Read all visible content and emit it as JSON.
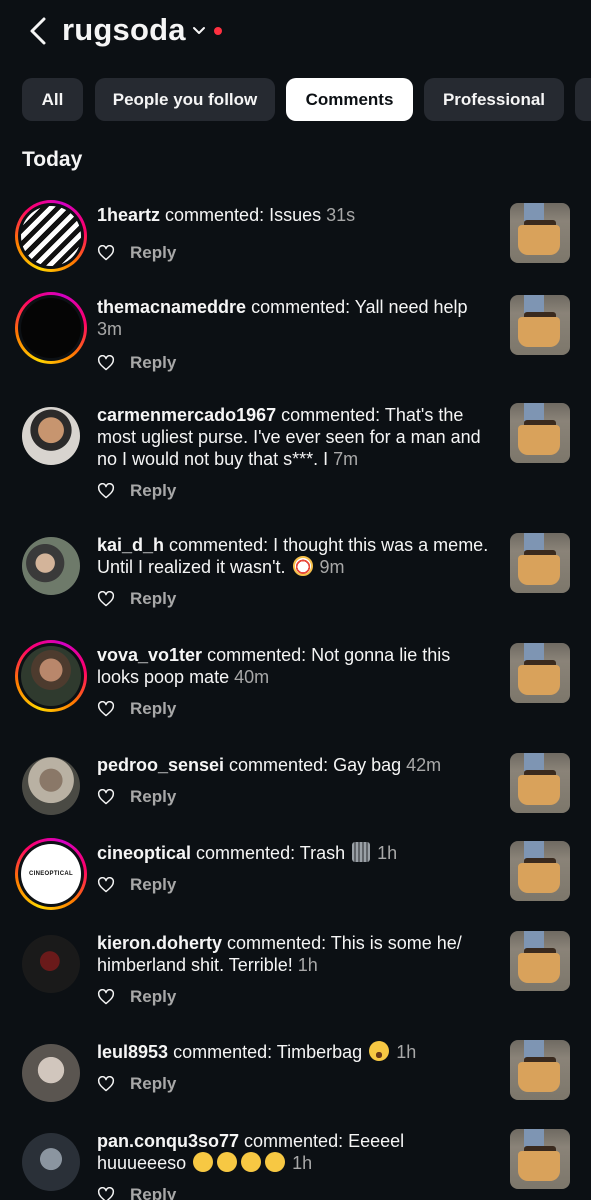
{
  "header": {
    "account": "rugsoda"
  },
  "tabs": [
    {
      "label": "All",
      "active": false
    },
    {
      "label": "People you follow",
      "active": false
    },
    {
      "label": "Comments",
      "active": true
    },
    {
      "label": "Professional",
      "active": false
    }
  ],
  "section": {
    "title": "Today"
  },
  "reply_label": "Reply",
  "comments": [
    {
      "user": "1heartz",
      "verb": "commented:",
      "text": "Issues",
      "emoji_after": "",
      "time": "31s"
    },
    {
      "user": "themacnameddre",
      "verb": "commented:",
      "text": "Yall need help",
      "emoji_after": "",
      "time": "3m"
    },
    {
      "user": "carmenmercado1967",
      "verb": "commented:",
      "text": "That's the most ugliest purse. I've ever seen for a man and no I would not buy that s***. I",
      "emoji_after": "",
      "time": "7m"
    },
    {
      "user": "kai_d_h",
      "verb": "commented:",
      "text": "I thought this was a meme. Until I realized it wasn't.",
      "emoji_after": "clown-face",
      "time": "9m"
    },
    {
      "user": "vova_vo1ter",
      "verb": "commented:",
      "text": "Not gonna lie this looks poop mate",
      "emoji_after": "",
      "time": "40m"
    },
    {
      "user": "pedroo_sensei",
      "verb": "commented:",
      "text": "Gay bag",
      "emoji_after": "",
      "time": "42m"
    },
    {
      "user": "cineoptical",
      "verb": "commented:",
      "text": "Trash",
      "emoji_after": "wastebasket",
      "time": "1h"
    },
    {
      "user": "kieron.doherty",
      "verb": "commented:",
      "text": "This is some he/ himberland shit. Terrible!",
      "emoji_after": "",
      "time": "1h"
    },
    {
      "user": "leul8953",
      "verb": "commented:",
      "text": "Timberbag",
      "emoji_after": "loudly-crying-face",
      "time": "1h"
    },
    {
      "user": "pan.conqu3so77",
      "verb": "commented:",
      "text": "Eeeeel huuueeeso",
      "emoji_after": "face-without-mouth x4",
      "time": "1h"
    }
  ],
  "avatar_logo_text": "CINEOPTICAL",
  "colors": {
    "background": "#0c1014",
    "tab": "#262a31",
    "tab_active": "#ffffff",
    "notification_dot": "#ff3040",
    "muted": "#a8a8a8"
  }
}
